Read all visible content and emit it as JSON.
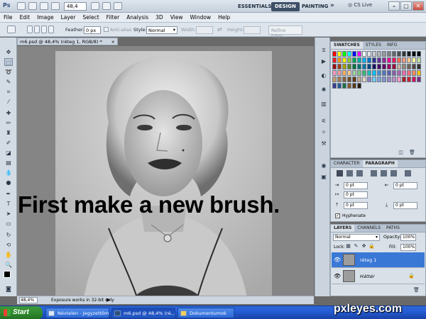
{
  "app": {
    "logo": "Ps",
    "zoom": "48,4",
    "workspaces": [
      "ESSENTIALS",
      "DESIGN",
      "PAINTING"
    ],
    "active_workspace": "DESIGN",
    "more": "»",
    "cs_live": "CS Live",
    "window_controls": {
      "minimize": "–",
      "restore": "□",
      "close": "✕"
    }
  },
  "menu": [
    "File",
    "Edit",
    "Image",
    "Layer",
    "Select",
    "Filter",
    "Analysis",
    "3D",
    "View",
    "Window",
    "Help"
  ],
  "options": {
    "feather_label": "Feather:",
    "feather_value": "0 px",
    "anti_alias_label": "Anti-alias",
    "style_label": "Style:",
    "style_value": "Normal",
    "width_label": "Width:",
    "height_label": "Height:",
    "refine_edge": "Refine Edge..."
  },
  "document": {
    "tab_title": "m6.psd @ 48,4% (réteg 1, RGB/8) *",
    "tab_close": "×",
    "caption": "First make a new brush.",
    "status_zoom": "48,4%",
    "status_message": "Exposure works in 32-bit only",
    "status_arrow": "▶"
  },
  "swatches": {
    "tabs": [
      "SWATCHES",
      "STYLES",
      "INFO"
    ],
    "active": "SWATCHES",
    "colors": [
      "#ff0000",
      "#ffff00",
      "#00ff00",
      "#00ffff",
      "#0000ff",
      "#ff00ff",
      "#ffffff",
      "#e6e6e6",
      "#cccccc",
      "#b3b3b3",
      "#999999",
      "#808080",
      "#666666",
      "#4d4d4d",
      "#333333",
      "#1a1a1a",
      "#000000",
      "#000000",
      "#ee1c24",
      "#f7941d",
      "#fff200",
      "#8dc63f",
      "#00a651",
      "#00a99d",
      "#00aeef",
      "#0072bc",
      "#2e3192",
      "#662d91",
      "#92278f",
      "#ec008c",
      "#ed145b",
      "#f26c4f",
      "#f69679",
      "#fdc689",
      "#fff799",
      "#c4df9b",
      "#9e0b0f",
      "#a0410d",
      "#aba000",
      "#598527",
      "#007236",
      "#00746b",
      "#0076a3",
      "#004a80",
      "#1b1464",
      "#440e62",
      "#630460",
      "#9e005d",
      "#9e0039",
      "#c7b299",
      "#998675",
      "#736357",
      "#534741",
      "#362f2d",
      "#f49ac1",
      "#f5989d",
      "#fbaf5d",
      "#fdc68a",
      "#a3d39c",
      "#7cc576",
      "#3bb878",
      "#1cbbb4",
      "#00bff3",
      "#448ccb",
      "#5674b9",
      "#605ca8",
      "#855fa8",
      "#a864a8",
      "#f06eaa",
      "#f26d7d",
      "#f68e56",
      "#ffc20e",
      "#c69c6d",
      "#a67c52",
      "#8c6239",
      "#754c24",
      "#603913",
      "#c2a888",
      "#e7d6c0",
      "#8781bd",
      "#6dcff6",
      "#7da7d9",
      "#8393ca",
      "#a186be",
      "#bd8cbf",
      "#f49ac2",
      "#aa1e23",
      "#c1272d",
      "#d4145a",
      "#7f2a82",
      "#3a3a8c",
      "#2b5797",
      "#1e7145",
      "#8a5b2e",
      "#5b3a1a",
      "#2a1a0a"
    ]
  },
  "character": {
    "tabs": [
      "CHARACTER",
      "PARAGRAPH"
    ],
    "active": "PARAGRAPH",
    "indent_left": "0 pt",
    "indent_right": "0 pt",
    "first_line": "0 pt",
    "space_before": "0 pt",
    "space_after": "0 pt",
    "hyphenate": "Hyphenate"
  },
  "layers": {
    "tabs": [
      "LAYERS",
      "CHANNELS",
      "PATHS"
    ],
    "active": "LAYERS",
    "blend_mode": "Normal",
    "opacity_label": "Opacity:",
    "opacity": "100%",
    "lock_label": "Lock:",
    "fill_label": "Fill:",
    "fill": "100%",
    "items": [
      {
        "name": "réteg 1",
        "selected": true
      },
      {
        "name": "Háttér",
        "selected": false,
        "locked": true
      }
    ]
  },
  "taskbar": {
    "start": "Start",
    "tasks": [
      "Névtelen - Jegyzettömb",
      "m6.psd @ 48,4% (ré...",
      "Dokumentumok"
    ],
    "active_task": 1
  },
  "watermark": "pxleyes.com"
}
